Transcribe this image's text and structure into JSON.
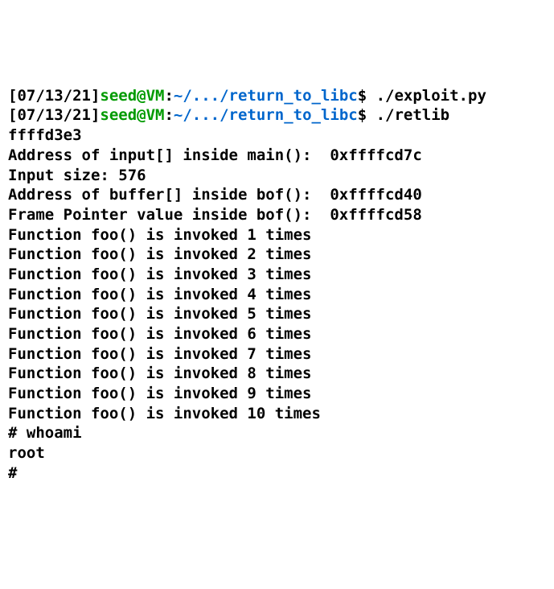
{
  "lines": [
    {
      "type": "prompt",
      "ts": "[07/13/21]",
      "user": "seed@VM",
      "path": "~/.../return_to_libc",
      "dollar": "$",
      "cmd": "./exploit.py"
    },
    {
      "type": "prompt",
      "ts": "[07/13/21]",
      "user": "seed@VM",
      "path": "~/.../return_to_libc",
      "dollar": "$",
      "cmd": "./retlib"
    },
    {
      "type": "out",
      "text": "ffffd3e3"
    },
    {
      "type": "out",
      "text": "Address of input[] inside main():  0xffffcd7c"
    },
    {
      "type": "out",
      "text": "Input size: 576"
    },
    {
      "type": "out",
      "text": "Address of buffer[] inside bof():  0xffffcd40"
    },
    {
      "type": "out",
      "text": "Frame Pointer value inside bof():  0xffffcd58"
    },
    {
      "type": "out",
      "text": "Function foo() is invoked 1 times"
    },
    {
      "type": "out",
      "text": "Function foo() is invoked 2 times"
    },
    {
      "type": "out",
      "text": "Function foo() is invoked 3 times"
    },
    {
      "type": "out",
      "text": "Function foo() is invoked 4 times"
    },
    {
      "type": "out",
      "text": "Function foo() is invoked 5 times"
    },
    {
      "type": "out",
      "text": "Function foo() is invoked 6 times"
    },
    {
      "type": "out",
      "text": "Function foo() is invoked 7 times"
    },
    {
      "type": "out",
      "text": "Function foo() is invoked 8 times"
    },
    {
      "type": "out",
      "text": "Function foo() is invoked 9 times"
    },
    {
      "type": "out",
      "text": "Function foo() is invoked 10 times"
    },
    {
      "type": "out",
      "text": "# whoami"
    },
    {
      "type": "out",
      "text": "root"
    },
    {
      "type": "out",
      "text": "# "
    }
  ]
}
